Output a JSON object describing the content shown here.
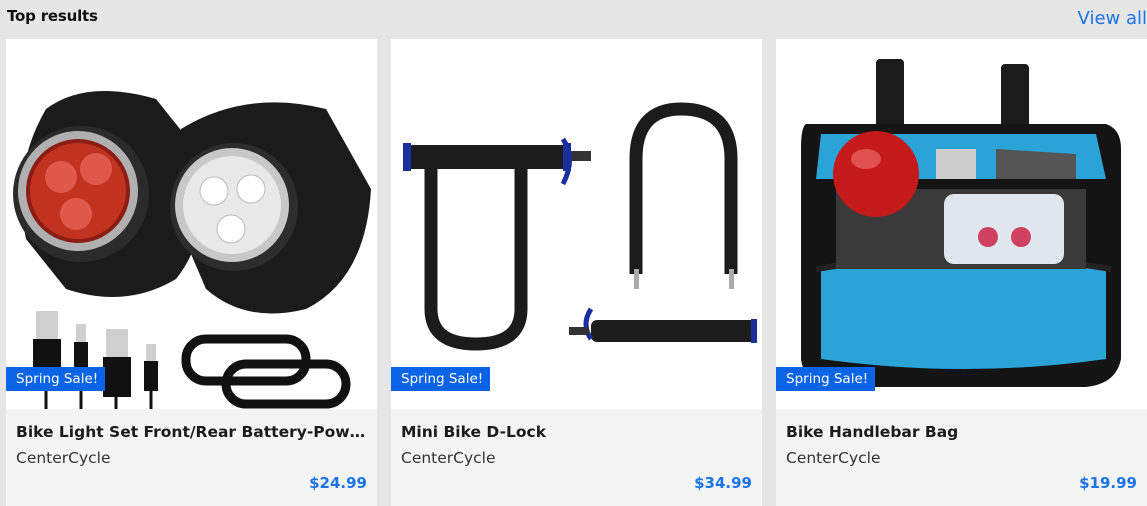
{
  "header": {
    "title": "Top results",
    "view_all": "View all"
  },
  "products": [
    {
      "image": "bike-light-set-image",
      "badge": "Spring Sale!",
      "name": "Bike Light Set Front/Rear Battery-Powered",
      "brand": "CenterCycle",
      "price": "$24.99"
    },
    {
      "image": "d-lock-image",
      "badge": "Spring Sale!",
      "name": "Mini Bike D-Lock",
      "brand": "CenterCycle",
      "price": "$34.99"
    },
    {
      "image": "handlebar-bag-image",
      "badge": "Spring Sale!",
      "name": "Bike Handlebar Bag",
      "brand": "CenterCycle",
      "price": "$19.99"
    }
  ],
  "colors": {
    "accent": "#1a73e8",
    "badge": "#0b63e5",
    "card_bg": "#f4f4f4",
    "page_bg": "#e6e6e6"
  }
}
